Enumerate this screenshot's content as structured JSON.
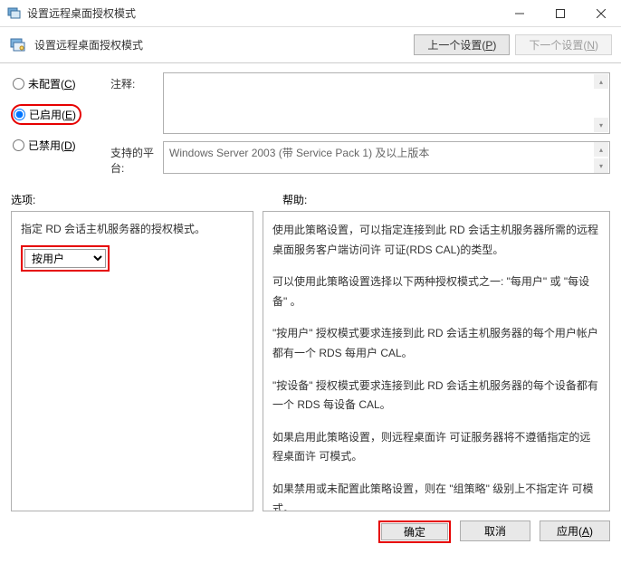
{
  "titlebar": {
    "title": "设置远程桌面授权模式"
  },
  "header": {
    "title": "设置远程桌面授权模式",
    "prev_button": "上一个设置(P)",
    "next_button": "下一个设置(N)"
  },
  "radios": {
    "not_configured": "未配置(C)",
    "enabled": "已启用(E)",
    "disabled": "已禁用(D)",
    "selected": "enabled"
  },
  "fields": {
    "annotation_label": "注释:",
    "platform_label": "支持的平台:",
    "platform_value": "Windows Server 2003 (带 Service Pack 1) 及以上版本"
  },
  "section_labels": {
    "options": "选项:",
    "help": "帮助:"
  },
  "options": {
    "description": "指定 RD 会话主机服务器的授权模式。",
    "select_value": "按用户"
  },
  "help": {
    "p1": "使用此策略设置，可以指定连接到此 RD 会话主机服务器所需的远程桌面服务客户端访问许 可证(RDS CAL)的类型。",
    "p2": "可以使用此策略设置选择以下两种授权模式之一: \"每用户\" 或 \"每设备\" 。",
    "p3": "\"按用户\" 授权模式要求连接到此 RD 会话主机服务器的每个用户帐户都有一个 RDS 每用户 CAL。",
    "p4": "\"按设备\" 授权模式要求连接到此 RD 会话主机服务器的每个设备都有一个 RDS 每设备 CAL。",
    "p5": "如果启用此策略设置，则远程桌面许 可证服务器将不遵循指定的远程桌面许 可模式。",
    "p6": "如果禁用或未配置此策略设置，则在 \"组策略\" 级别上不指定许 可模式。"
  },
  "footer": {
    "ok": "确定",
    "cancel": "取消",
    "apply": "应用(A)"
  }
}
